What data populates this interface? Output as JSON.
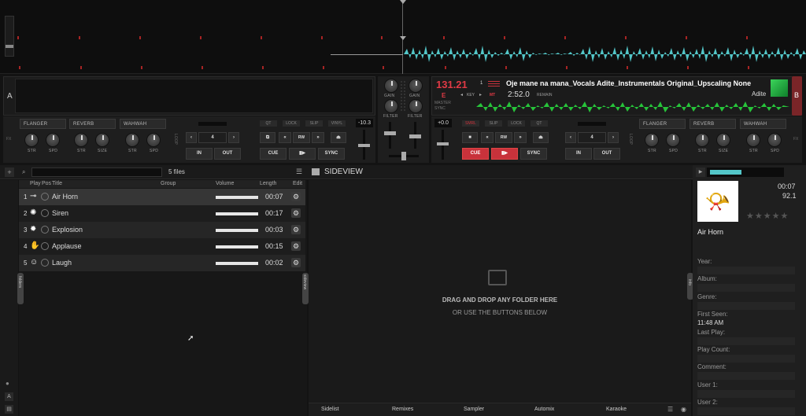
{
  "deck_a": {
    "letter": "A",
    "fx": [
      "FLANGER",
      "REVERB",
      "WAHWAH"
    ],
    "knobs": [
      "STR",
      "SPD",
      "STR",
      "SIZE",
      "STR",
      "SPD"
    ],
    "loop": "4",
    "loop_label": "LOOP",
    "in": "IN",
    "out": "OUT",
    "btns": [
      "QT",
      "LOCK",
      "SLIP",
      "VINYL"
    ],
    "transport": [
      "CUE",
      "▮▶",
      "SYNC"
    ],
    "pitch": "-10.3",
    "rw": "RW",
    "fx_label": "FX"
  },
  "deck_b": {
    "letter": "B",
    "bpm": "131.21",
    "key_letter": "E",
    "key_label": "KEY",
    "mt": "MT",
    "deck_num": "1",
    "title": "Oje mane na mana_Vocals Adite_Instrumentals Original_Upscaling None",
    "time": "2:52.0",
    "remain": "REMAIN",
    "artist": "Adite",
    "master": "MASTER",
    "sync": "SYNC",
    "pitch": "+0.0",
    "btns": [
      "SMRL",
      "SLIP",
      "LOCK",
      "QT"
    ],
    "transport": [
      "CUE",
      "▮▶",
      "SYNC"
    ],
    "loop": "4",
    "loop_label": "LOOP",
    "in": "IN",
    "out": "OUT",
    "fx": [
      "FLANGER",
      "REVERB",
      "WAHWAH"
    ],
    "knobs": [
      "STR",
      "SPD",
      "STR",
      "SIZE",
      "STR",
      "SPD"
    ],
    "rw": "RW",
    "fx_label": "FX"
  },
  "mixer": {
    "gain": "GAIN",
    "filter": "FILTER"
  },
  "browser": {
    "file_count": "5 files",
    "headers": [
      "Play",
      "Pos",
      "Title",
      "Group",
      "Volume",
      "Length",
      "Edit"
    ],
    "rows": [
      {
        "num": "1",
        "title": "Air Horn",
        "length": "00:07",
        "icon": "horn-icon"
      },
      {
        "num": "2",
        "title": "Siren",
        "length": "00:17",
        "icon": "siren-icon"
      },
      {
        "num": "3",
        "title": "Explosion",
        "length": "00:03",
        "icon": "explosion-icon"
      },
      {
        "num": "4",
        "title": "Applause",
        "length": "00:15",
        "icon": "applause-icon"
      },
      {
        "num": "5",
        "title": "Laugh",
        "length": "00:02",
        "icon": "laugh-icon"
      }
    ],
    "folders_tab": "folders",
    "sideview_tab": "sideview"
  },
  "sideview": {
    "title": "SIDEVIEW",
    "drop1": "DRAG AND DROP ANY FOLDER HERE",
    "drop2": "OR USE THE BUTTONS BELOW"
  },
  "bottom_tabs": [
    "Sidelist",
    "Remixes",
    "Sampler",
    "Automix",
    "Karaoke"
  ],
  "info": {
    "time": "00:07",
    "bpm": "92.1",
    "title": "Air Horn",
    "tab": "info",
    "fields": [
      {
        "label": "Year:",
        "value": ""
      },
      {
        "label": "Album:",
        "value": ""
      },
      {
        "label": "Genre:",
        "value": ""
      },
      {
        "label": "First Seen:",
        "value": "11:48 AM"
      },
      {
        "label": "Last Play:",
        "value": ""
      },
      {
        "label": "Play Count:",
        "value": ""
      },
      {
        "label": "Comment:",
        "value": ""
      },
      {
        "label": "User 1:",
        "value": ""
      },
      {
        "label": "User 2:",
        "value": ""
      }
    ]
  },
  "colors": {
    "wave": "#53c6c8",
    "accent_red": "#c8323b",
    "green": "#27c33a"
  }
}
